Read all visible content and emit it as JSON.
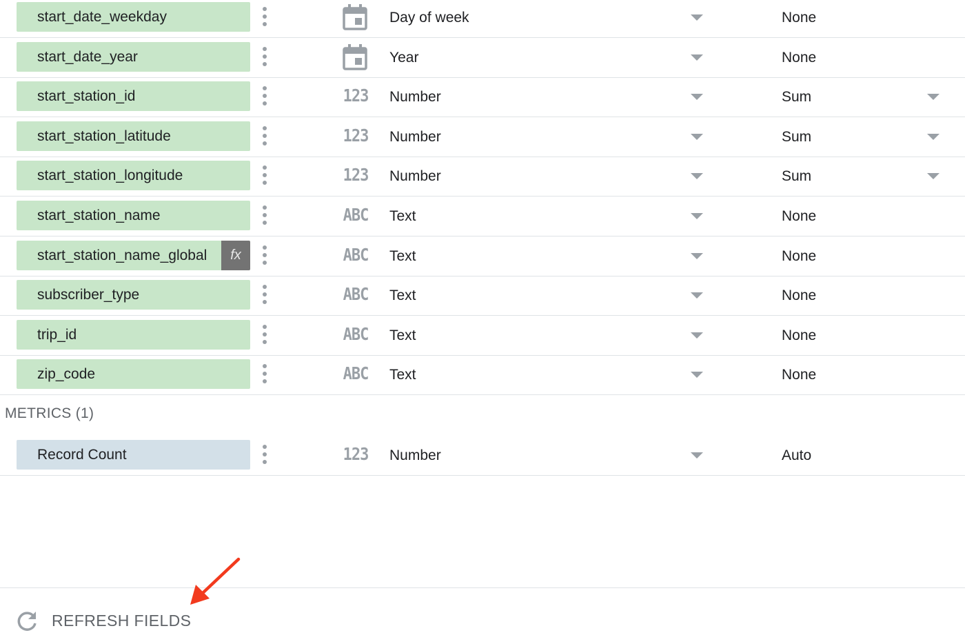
{
  "dimensions": [
    {
      "name": "start_date_weekday",
      "type_icon": "calendar-icon",
      "type": "Day of week",
      "aggregation": "None",
      "agg_dropdown": false,
      "calculated": false
    },
    {
      "name": "start_date_year",
      "type_icon": "calendar-icon",
      "type": "Year",
      "aggregation": "None",
      "agg_dropdown": false,
      "calculated": false
    },
    {
      "name": "start_station_id",
      "type_icon": "number-icon",
      "type_icon_text": "123",
      "type": "Number",
      "aggregation": "Sum",
      "agg_dropdown": true,
      "calculated": false
    },
    {
      "name": "start_station_latitude",
      "type_icon": "number-icon",
      "type_icon_text": "123",
      "type": "Number",
      "aggregation": "Sum",
      "agg_dropdown": true,
      "calculated": false
    },
    {
      "name": "start_station_longitude",
      "type_icon": "number-icon",
      "type_icon_text": "123",
      "type": "Number",
      "aggregation": "Sum",
      "agg_dropdown": true,
      "calculated": false
    },
    {
      "name": "start_station_name",
      "type_icon": "text-icon",
      "type_icon_text": "ABC",
      "type": "Text",
      "aggregation": "None",
      "agg_dropdown": false,
      "calculated": false
    },
    {
      "name": "start_station_name_global",
      "type_icon": "text-icon",
      "type_icon_text": "ABC",
      "type": "Text",
      "aggregation": "None",
      "agg_dropdown": false,
      "calculated": true,
      "calc_badge": "fx"
    },
    {
      "name": "subscriber_type",
      "type_icon": "text-icon",
      "type_icon_text": "ABC",
      "type": "Text",
      "aggregation": "None",
      "agg_dropdown": false,
      "calculated": false
    },
    {
      "name": "trip_id",
      "type_icon": "text-icon",
      "type_icon_text": "ABC",
      "type": "Text",
      "aggregation": "None",
      "agg_dropdown": false,
      "calculated": false
    },
    {
      "name": "zip_code",
      "type_icon": "text-icon",
      "type_icon_text": "ABC",
      "type": "Text",
      "aggregation": "None",
      "agg_dropdown": false,
      "calculated": false
    }
  ],
  "metrics_section": {
    "title": "METRICS (1)"
  },
  "metrics": [
    {
      "name": "Record Count",
      "type_icon": "number-icon",
      "type_icon_text": "123",
      "type": "Number",
      "aggregation": "Auto",
      "agg_dropdown": false,
      "calculated": false
    }
  ],
  "refresh": {
    "label": "REFRESH FIELDS",
    "icon": "refresh-icon"
  },
  "annotation": {
    "icon": "red-arrow-icon",
    "color": "#f23a1d"
  },
  "colors": {
    "dimension_chip": "#c8e6c9",
    "metric_chip": "#d3e0e8",
    "icon_gray": "#9aa0a6",
    "divider": "#dfe3e6"
  }
}
